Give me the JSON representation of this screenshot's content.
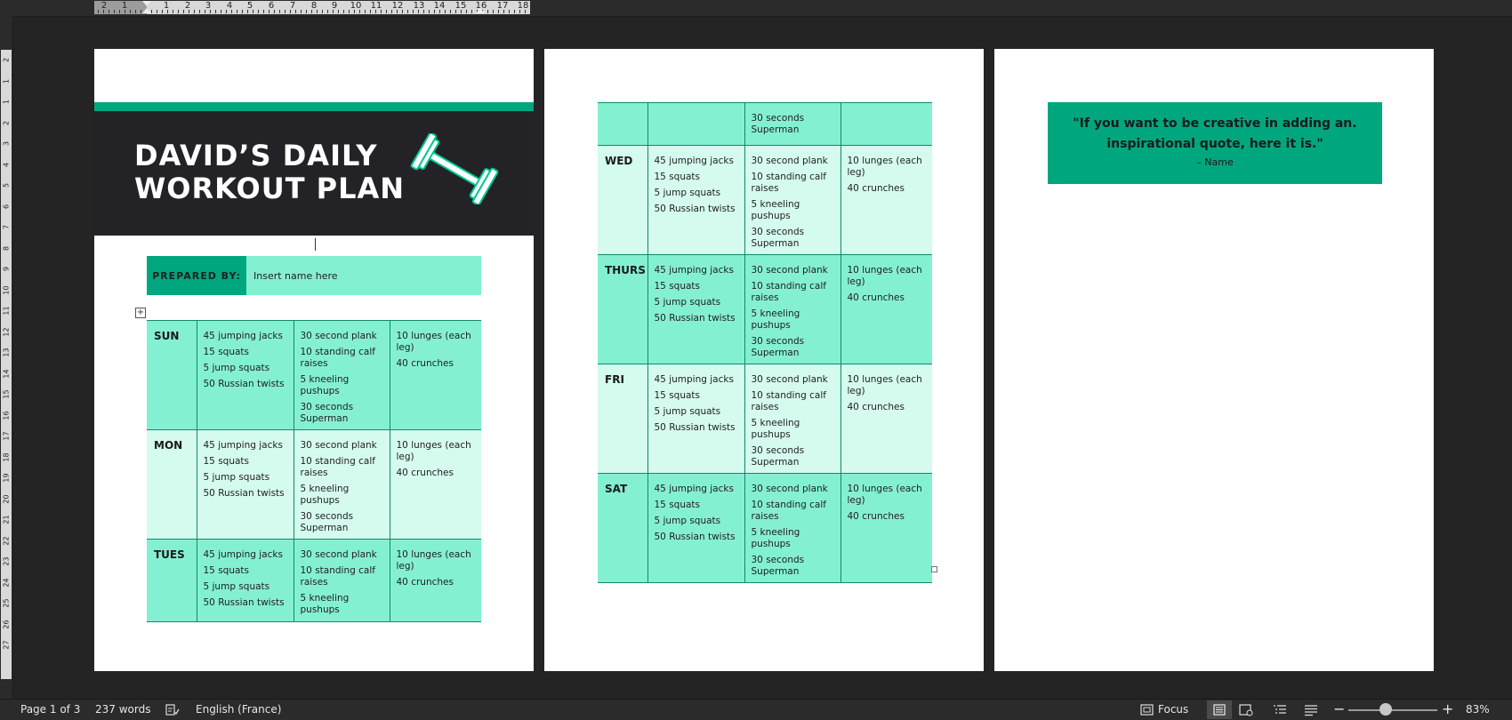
{
  "ruler": {
    "horizontal_labels": [
      "2",
      "1",
      "1",
      "2",
      "3",
      "4",
      "5",
      "6",
      "7",
      "8",
      "9",
      "10",
      "11",
      "12",
      "13",
      "14",
      "15",
      "16",
      "17",
      "18"
    ],
    "vertical_labels": [
      "2",
      "1",
      "1",
      "2",
      "3",
      "4",
      "5",
      "6",
      "7",
      "8",
      "9",
      "10",
      "11",
      "12",
      "13",
      "14",
      "15",
      "16",
      "17",
      "18",
      "19",
      "20",
      "21",
      "22",
      "23",
      "24",
      "25",
      "26",
      "27"
    ]
  },
  "doc": {
    "title_line1": "DAVID’S DAILY",
    "title_line2": "WORKOUT PLAN",
    "prepared_label": "PREPARED BY:",
    "prepared_value": "Insert name here",
    "table1": [
      {
        "day": "SUN",
        "cols": [
          [
            "45 jumping jacks",
            "15 squats",
            "5 jump squats",
            "50 Russian twists"
          ],
          [
            "30 second plank",
            "10 standing calf raises",
            "5 kneeling pushups",
            "30 seconds Superman"
          ],
          [
            "10 lunges (each leg)",
            "40 crunches"
          ]
        ]
      },
      {
        "day": "MON",
        "cols": [
          [
            "45 jumping jacks",
            "15 squats",
            "5 jump squats",
            "50 Russian twists"
          ],
          [
            "30 second plank",
            "10 standing calf raises",
            "5 kneeling pushups",
            "30 seconds Superman"
          ],
          [
            "10 lunges (each leg)",
            "40 crunches"
          ]
        ]
      },
      {
        "day": "TUES",
        "cols": [
          [
            "45 jumping jacks",
            "15 squats",
            "5 jump squats",
            "50 Russian twists"
          ],
          [
            "30 second plank",
            "10 standing calf raises",
            "5 kneeling pushups"
          ],
          [
            "10 lunges (each leg)",
            "40 crunches"
          ]
        ]
      }
    ],
    "table2": [
      {
        "day": "",
        "cols": [
          [],
          [
            "30 seconds Superman"
          ],
          []
        ]
      },
      {
        "day": "WED",
        "cols": [
          [
            "45 jumping jacks",
            "15 squats",
            "5 jump squats",
            "50 Russian twists"
          ],
          [
            "30 second plank",
            "10 standing calf raises",
            "5 kneeling pushups",
            "30 seconds Superman"
          ],
          [
            "10 lunges (each leg)",
            "40 crunches"
          ]
        ]
      },
      {
        "day": "THURS",
        "cols": [
          [
            "45 jumping jacks",
            "15 squats",
            "5 jump squats",
            "50 Russian twists"
          ],
          [
            "30 second plank",
            "10 standing calf raises",
            "5 kneeling pushups",
            "30 seconds Superman"
          ],
          [
            "10 lunges (each leg)",
            "40 crunches"
          ]
        ]
      },
      {
        "day": "FRI",
        "cols": [
          [
            "45 jumping jacks",
            "15 squats",
            "5 jump squats",
            "50 Russian twists"
          ],
          [
            "30 second plank",
            "10 standing calf raises",
            "5 kneeling pushups",
            "30 seconds Superman"
          ],
          [
            "10 lunges (each leg)",
            "40 crunches"
          ]
        ]
      },
      {
        "day": "SAT",
        "cols": [
          [
            "45 jumping jacks",
            "15 squats",
            "5 jump squats",
            "50 Russian twists"
          ],
          [
            "30 second plank",
            "10 standing calf raises",
            "5 kneeling pushups",
            "30 seconds Superman"
          ],
          [
            "10 lunges (each leg)",
            "40 crunches"
          ]
        ]
      }
    ],
    "quote_text": "\"If you want to be creative in adding an. inspirational quote, here it is.\"",
    "quote_name": "– Name"
  },
  "status": {
    "page": "Page 1 of 3",
    "words": "237 words",
    "language": "English (France)",
    "focus": "Focus",
    "zoom": "83%",
    "zoom_level": 0.42
  },
  "colors": {
    "accent": "#00a77e",
    "row_dark": "#84f0d2",
    "row_light": "#d5fbef",
    "banner": "#232327"
  }
}
